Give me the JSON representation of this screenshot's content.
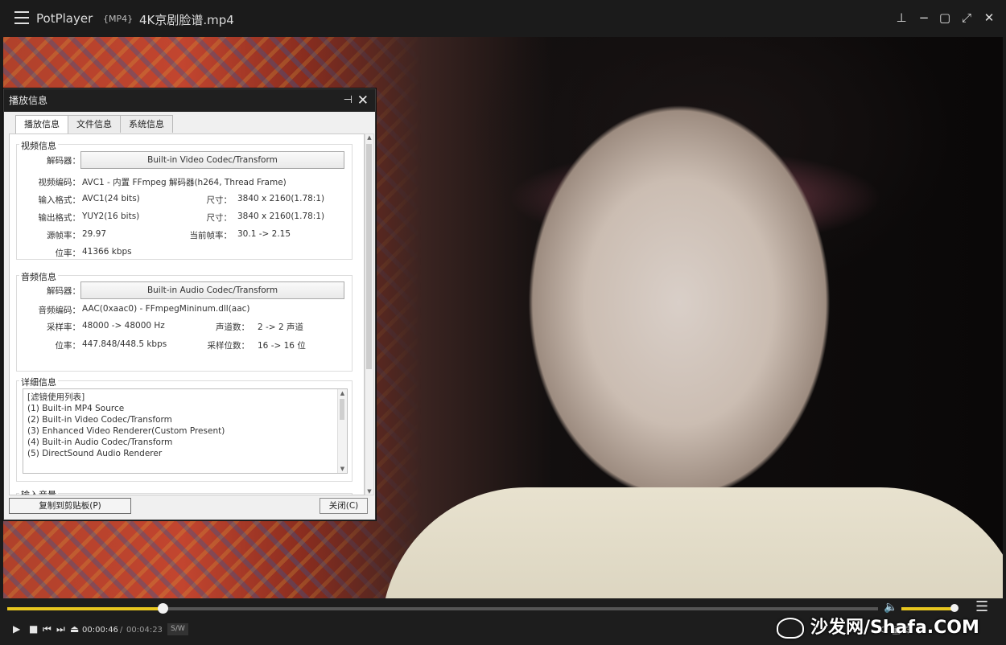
{
  "titlebar": {
    "app_name": "PotPlayer",
    "format": "{MP4}",
    "filename": "4K京剧脸谱.mp4"
  },
  "dialog": {
    "title": "播放信息",
    "tabs": [
      "播放信息",
      "文件信息",
      "系统信息"
    ],
    "video": {
      "group_label": "视频信息",
      "decoder_label": "解码器：",
      "decoder_value": "Built-in Video Codec/Transform",
      "codec_label": "视频编码：",
      "codec_value": "AVC1 - 内置 FFmpeg 解码器(h264, Thread Frame)",
      "input_format_label": "输入格式：",
      "input_format_value": "AVC1(24 bits)",
      "input_size_label": "尺寸：",
      "input_size_value": "3840 x 2160(1.78:1)",
      "output_format_label": "输出格式：",
      "output_format_value": "YUY2(16 bits)",
      "output_size_label": "尺寸：",
      "output_size_value": "3840 x 2160(1.78:1)",
      "src_fps_label": "源帧率：",
      "src_fps_value": "29.97",
      "cur_fps_label": "当前帧率：",
      "cur_fps_value": "30.1 -> 2.15",
      "bitrate_label": "位率：",
      "bitrate_value": "41366 kbps"
    },
    "audio": {
      "group_label": "音频信息",
      "decoder_label": "解码器：",
      "decoder_value": "Built-in Audio Codec/Transform",
      "codec_label": "音频编码：",
      "codec_value": "AAC(0xaac0) - FFmpegMininum.dll(aac)",
      "samplerate_label": "采样率：",
      "samplerate_value": "48000 -> 48000 Hz",
      "channels_label": "声道数：",
      "channels_value": "2 -> 2 声道",
      "bitrate_label": "位率：",
      "bitrate_value": "447.848/448.5 kbps",
      "bits_label": "采样位数：",
      "bits_value": "16 -> 16 位"
    },
    "detail": {
      "group_label": "详细信息",
      "lines": [
        "[滤镜使用列表]",
        "(1) Built-in MP4 Source",
        "(2) Built-in Video Codec/Transform",
        "(3) Enhanced Video Renderer(Custom Present)",
        "(4) Built-in Audio Codec/Transform",
        "(5) DirectSound Audio Renderer"
      ]
    },
    "input_volume_label": "输入音量",
    "copy_button": "复制到剪贴板(P)",
    "close_button": "关闭(C)"
  },
  "controls": {
    "seek_progress": 0.178,
    "volume_level": 1.0,
    "time_current": "00:00:46",
    "time_separator": "/",
    "time_total": "00:04:23",
    "sw_label": "S/W"
  },
  "watermark": "沙发网/Shafa.COM",
  "colors": {
    "accent": "#e8c71f",
    "titlebar_bg": "#1b1b1b",
    "dialog_bg": "#f0f0f0"
  }
}
